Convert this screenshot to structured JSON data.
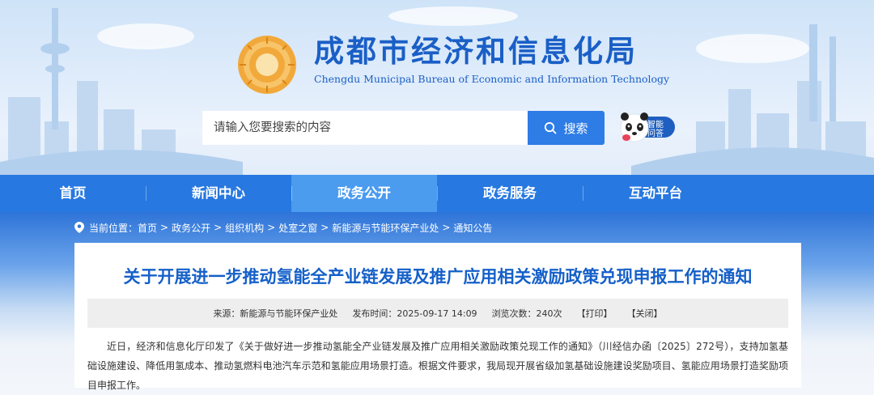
{
  "header": {
    "title": "成都市经济和信息化局",
    "subtitle": "Chengdu Municipal Bureau of Economic and Information Technology",
    "logo_icon": "chengdu-sun-bird-logo",
    "search": {
      "placeholder": "请输入您要搜索的内容",
      "value": "",
      "button_label": "搜索",
      "button_icon": "search-icon"
    },
    "ai_assistant": {
      "label_line1": "智能",
      "label_line2": "问答",
      "icon": "panda-icon"
    }
  },
  "nav": {
    "items": [
      {
        "label": "首页"
      },
      {
        "label": "新闻中心"
      },
      {
        "label": "政务公开",
        "active": true
      },
      {
        "label": "政务服务"
      },
      {
        "label": "互动平台"
      }
    ]
  },
  "breadcrumb": {
    "prefix": "当前位置：",
    "items": [
      "首页",
      "政务公开",
      "组织机构",
      "处室之窗",
      "新能源与节能环保产业处",
      "通知公告"
    ],
    "separator": ">"
  },
  "article": {
    "title": "关于开展进一步推动氢能全产业链发展及推广应用相关激励政策兑现申报工作的通知",
    "meta": {
      "source": "来源：新能源与节能环保产业处",
      "publish_time": "发布时间：2025-09-17 14:09",
      "views": "浏览次数：240次",
      "print": "【打印】",
      "close": "【关闭】"
    },
    "body": "近日，经济和信息化厅印发了《关于做好进一步推动氢能全产业链发展及推广应用相关激励政策兑现工作的通知》（川经信办函〔2025〕272号），支持加氢基础设施建设、降低用氢成本、推动氢燃料电池汽车示范和氢能应用场景打造。根据文件要求，我局现开展省级加氢基础设施建设奖励项目、氢能应用场景打造奖励项目申报工作。"
  },
  "colors": {
    "brand_blue": "#1a5fc6",
    "nav_blue": "#2778e0",
    "nav_active": "#4b9bef",
    "search_button": "#2e7ce6",
    "logo_gold": "#f2a93b"
  }
}
